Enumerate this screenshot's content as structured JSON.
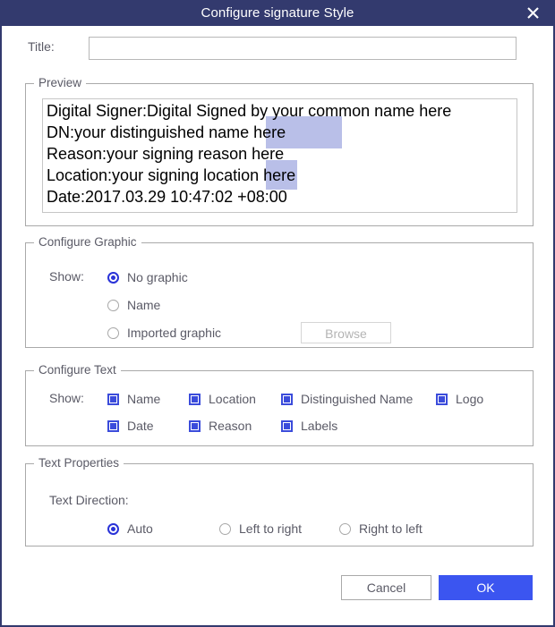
{
  "window": {
    "title": "Configure signature Style",
    "close_icon": "close-icon",
    "titlebar_color": "#333a6e"
  },
  "title_field": {
    "label": "Title:",
    "value": "",
    "placeholder": ""
  },
  "preview": {
    "group_label": "Preview",
    "lines": [
      "Digital Signer:Digital Signed by your common name here",
      "DN:your distinguished name here",
      "Reason:your signing reason here",
      "Location:your signing location here",
      "Date:2017.03.29 10:47:02 +08:00"
    ],
    "selection_color": "#b9bfe8"
  },
  "configure_graphic": {
    "group_label": "Configure Graphic",
    "show_label": "Show:",
    "options": [
      {
        "label": "No graphic",
        "checked": true
      },
      {
        "label": "Name",
        "checked": false
      },
      {
        "label": "Imported graphic",
        "checked": false
      }
    ],
    "browse_label": "Browse",
    "browse_enabled": false
  },
  "configure_text": {
    "group_label": "Configure Text",
    "show_label": "Show:",
    "options": [
      {
        "label": "Name",
        "checked": true
      },
      {
        "label": "Location",
        "checked": true
      },
      {
        "label": "Distinguished Name",
        "checked": true
      },
      {
        "label": "Logo",
        "checked": true
      },
      {
        "label": "Date",
        "checked": true
      },
      {
        "label": "Reason",
        "checked": true
      },
      {
        "label": "Labels",
        "checked": true
      }
    ]
  },
  "text_properties": {
    "group_label": "Text Properties",
    "direction_label": "Text Direction:",
    "options": [
      {
        "label": "Auto",
        "checked": true
      },
      {
        "label": "Left to right",
        "checked": false
      },
      {
        "label": "Right to left",
        "checked": false
      }
    ]
  },
  "footer": {
    "cancel_label": "Cancel",
    "ok_label": "OK",
    "ok_color": "#3b55f0"
  }
}
